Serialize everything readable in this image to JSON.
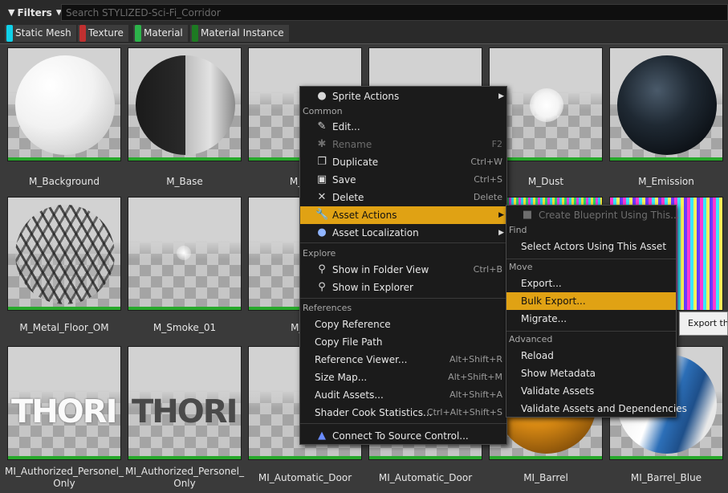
{
  "toolbar": {
    "filters_label": "Filters",
    "search_placeholder": "Search STYLIZED-Sci-Fi_Corridor"
  },
  "filter_chips": [
    {
      "label": "Static Mesh",
      "color": "#10d0e8"
    },
    {
      "label": "Texture",
      "color": "#c03030"
    },
    {
      "label": "Material",
      "color": "#2cb34a"
    },
    {
      "label": "Material Instance",
      "color": "#1d7a22"
    }
  ],
  "assets": [
    {
      "label": "M_Background"
    },
    {
      "label": "M_Base"
    },
    {
      "label": "M_Bas"
    },
    {
      "label": ""
    },
    {
      "label": "M_Dust"
    },
    {
      "label": "M_Emission"
    },
    {
      "label": "M_Metal_Floor_OM"
    },
    {
      "label": "M_Smoke_01"
    },
    {
      "label": "M_Sm"
    },
    {
      "label": ""
    },
    {
      "label": ""
    },
    {
      "label": ""
    },
    {
      "label": "MI_Authorized_Personel_ Only"
    },
    {
      "label": "MI_Authorized_Personel_ Only"
    },
    {
      "label": "MI_Automatic_Door"
    },
    {
      "label": "MI_Automatic_Door"
    },
    {
      "label": "MI_Barrel"
    },
    {
      "label": "MI_Barrel_Blue"
    }
  ],
  "context_menu": {
    "sprite_actions": "Sprite Actions",
    "sections": {
      "common": "Common",
      "explore": "Explore",
      "references": "References"
    },
    "items": {
      "edit": {
        "label": "Edit...",
        "shortcut": ""
      },
      "rename": {
        "label": "Rename",
        "shortcut": "F2"
      },
      "duplicate": {
        "label": "Duplicate",
        "shortcut": "Ctrl+W"
      },
      "save": {
        "label": "Save",
        "shortcut": "Ctrl+S"
      },
      "delete": {
        "label": "Delete",
        "shortcut": "Delete"
      },
      "asset_actions": {
        "label": "Asset Actions"
      },
      "asset_localization": {
        "label": "Asset Localization"
      },
      "show_folder": {
        "label": "Show in Folder View",
        "shortcut": "Ctrl+B"
      },
      "show_explorer": {
        "label": "Show in Explorer"
      },
      "copy_reference": {
        "label": "Copy Reference"
      },
      "copy_file_path": {
        "label": "Copy File Path"
      },
      "reference_viewer": {
        "label": "Reference Viewer...",
        "shortcut": "Alt+Shift+R"
      },
      "size_map": {
        "label": "Size Map...",
        "shortcut": "Alt+Shift+M"
      },
      "audit_assets": {
        "label": "Audit Assets...",
        "shortcut": "Alt+Shift+A"
      },
      "shader_cook": {
        "label": "Shader Cook Statistics...",
        "shortcut": "Ctrl+Alt+Shift+S"
      },
      "source_control": {
        "label": "Connect To Source Control..."
      }
    }
  },
  "submenu": {
    "create_blueprint": "Create Blueprint Using This...",
    "sections": {
      "find": "Find",
      "move": "Move",
      "advanced": "Advanced"
    },
    "select_actors": "Select Actors Using This Asset",
    "export": "Export...",
    "bulk_export": "Bulk Export...",
    "migrate": "Migrate...",
    "reload": "Reload",
    "show_metadata": "Show Metadata",
    "validate_assets": "Validate Assets",
    "validate_deps": "Validate Assets and Dependencies"
  },
  "tooltip": {
    "text": "Export the"
  },
  "colors": {
    "highlight": "#e0a214",
    "material_bar": "#27a92b"
  }
}
